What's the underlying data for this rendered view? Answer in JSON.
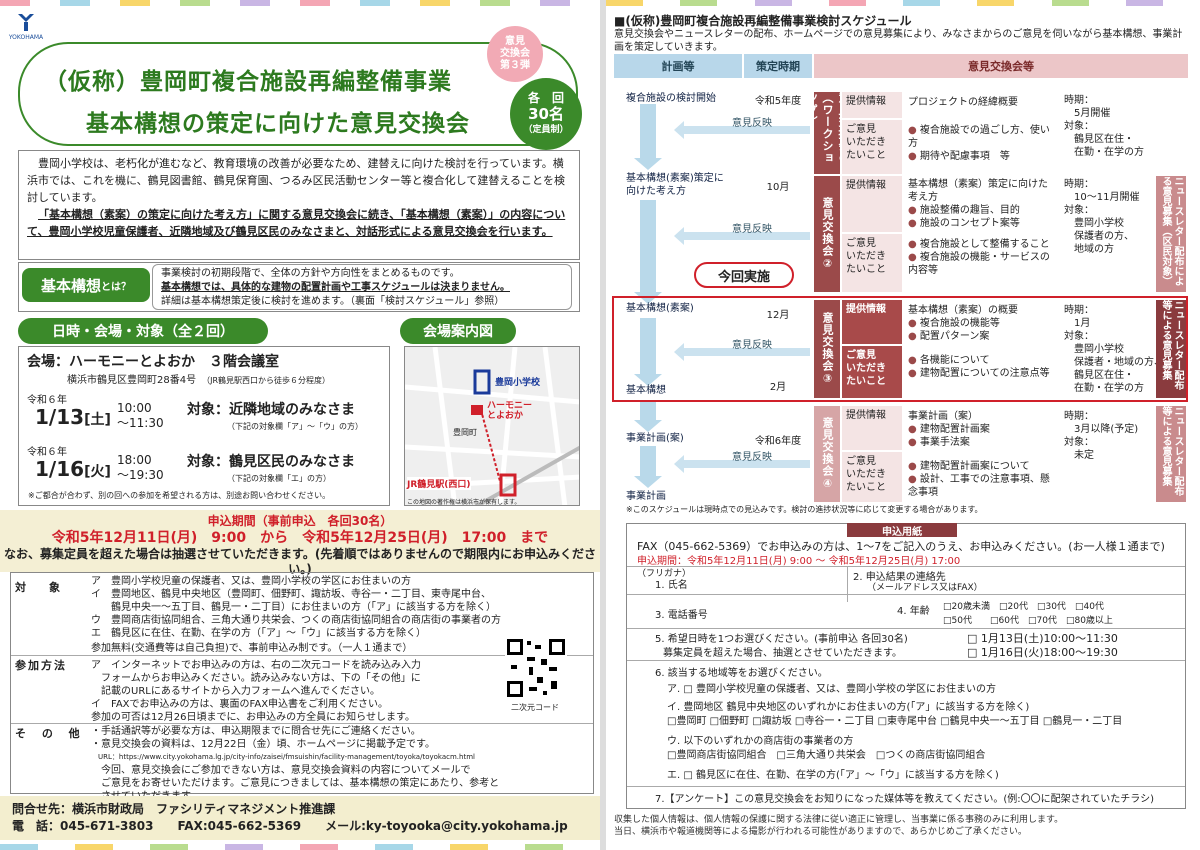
{
  "left": {
    "logo": {
      "text": "YOKOHAMA",
      "caption": "ヨコハマ"
    },
    "title_line1": "（仮称）豊岡町複合施設再編整備事業",
    "title_line2": "基本構想の策定に向けた意見交換会",
    "badge_round": [
      "意見",
      "交換会",
      "第３弾"
    ],
    "badge_capacity": [
      "各　回",
      "30名",
      "（定員制）"
    ],
    "intro": [
      "豊岡小学校は、老朽化が進むなど、教育環境の改善が必要なため、建替えに向けた検討を行っています。横浜市では、これを機に、鶴見図書館、鶴見保育園、つるみ区民活動センター等と複合化して建替えることを検討しています。",
      "「基本構想（素案）の策定に向けた考え方」に関する意見交換会に続き、「基本構想（素案）」の内容について、豊岡小学校児童保護者、近隣地域及び鶴見区民のみなさまと、対話形式による意見交換会を行います。"
    ],
    "kihon_label": "基本構想",
    "kihon_q": "とは？",
    "kihon_text": [
      "事業検討の初期段階で、全体の方針や方向性をまとめるものです。",
      "基本構想では、具体的な建物の配置計画や工事スケジュールは決まりません。",
      "詳細は基本構想策定後に検討を進めます。（裏面「検討スケジュール」参照）"
    ],
    "sec_datetime": "日時・会場・対象（全２回）",
    "sec_map": "会場案内図",
    "venue_label": "会場：ハーモニーとよおか　３階会議室",
    "venue_addr": "横浜市鶴見区豊岡町28番4号",
    "venue_access": "（JR鶴見駅西口から徒歩６分程度）",
    "session1": {
      "era": "令和６年",
      "date": "1/13",
      "dow": "[土]",
      "time1": "10:00",
      "time2": "～11:30",
      "target": "対象：近隣地域のみなさま",
      "note": "（下記の対象欄「ア」～「ウ」の方）"
    },
    "session2": {
      "era": "令和６年",
      "date": "1/16",
      "dow": "[火]",
      "time1": "18:00",
      "time2": "～19:30",
      "target": "対象：鶴見区民のみなさま",
      "note": "（下記の対象欄「エ」の方）"
    },
    "venue_footnote": "※ご都合が合わず、別の回への参加を希望される方は、別途お問い合わせください。",
    "map": {
      "school": "豊岡小学校",
      "harmony": "ハーモニー\nとよおか",
      "station": "JR鶴見駅(西口)",
      "town": "豊岡町",
      "caption": "この地図の著作権は横浜市が保有します。"
    },
    "apply": {
      "line1": "申込期間（事前申込　各回30名）",
      "line2": "令和5年12月11日(月)　9:00　から　令和5年12月25日(月)　17:00　まで",
      "line3": "なお、募集定員を超えた場合は抽選させていただきます。(先着順ではありませんので期限内にお申込みください。)"
    },
    "taisho_label": "対　象",
    "taisho": [
      "ア　豊岡小学校児童の保護者、又は、豊岡小学校の学区にお住まいの方",
      "イ　豊岡地区、鶴見中央地区（豊岡町、佃野町、諏訪坂、寺谷一・二丁目、東寺尾中台、",
      "　　鶴見中央一～五丁目、鶴見一・二丁目）にお住まいの方（「ア」に該当する方を除く）",
      "ウ　豊岡商店街協同組合、三角大通り共栄会、つくの商店街協同組合の商店街の事業者の方",
      "エ　鶴見区に在住、在勤、在学の方（「ア」～「ウ」に該当する方を除く）",
      "参加無料(交通費等は自己負担)で、事前申込み制です。（一人１通まで）"
    ],
    "method_label": "参加方法",
    "method": [
      "ア　インターネットでお申込みの方は、右の二次元コードを読み込み入力",
      "　フォームからお申込みください。読み込みない方は、下の「その他」に",
      "　記載のURLにあるサイトから入力フォームへ進んでください。",
      "イ　FAXでお申込みの方は、裏面のFAX申込書をご利用ください。",
      "参加の可否は12月26日頃までに、お申込みの方全員にお知らせします。"
    ],
    "qr_caption": "二次元コード",
    "other_label": "そ の 他",
    "other": [
      "・手話通訳等が必要な方は、申込期限までに問合せ先にご連絡ください。",
      "・意見交換会の資料は、12月22日（金）頃、ホームページに掲載予定です。",
      "　URL：https://www.city.yokohama.lg.jp/city-info/zaisei/fmsuishin/facility-management/toyoka/toyokacm.html",
      "　今回、意見交換会にご参加できない方は、意見交換会資料の内容についてメールで",
      "　ご意見をお寄せいただけます。ご意見につきましては、基本構想の策定にあたり、参考と",
      "　させていただきます。"
    ],
    "contact1": "問合せ先：横浜市財政局　ファシリティマネジメント推進課",
    "contact2": "電　話：045-671-3803　　FAX:045-662-5369　　メール:ky-toyooka@city.yokohama.jp"
  },
  "right": {
    "heading": "■(仮称)豊岡町複合施設再編整備事業検討スケジュール",
    "sub": "意見交換会やニュースレターの配布、ホームページでの意見募集により、みなさまからのご意見を伺いながら基本構想、事業計画を策定していきます。",
    "col_plan": "計画等",
    "col_time": "策定時期",
    "col_meeting": "意見交換会等",
    "steps": [
      "複合施設の検討開始",
      "基本構想(素案)策定に\n向けた考え方",
      "基本構想(素案)",
      "基本構想",
      "事業計画(案)",
      "事業計画"
    ],
    "whens": [
      "令和5年度",
      "10月",
      "12月",
      "2月",
      "令和6年度"
    ],
    "feedback": "意見反映",
    "now": "今回実施",
    "meetings": [
      {
        "label": "意見交換会①（ワークショップ）",
        "info": "提供情報",
        "info_text": "プロジェクトの経緯概要",
        "ask": "ご意見\nいただき\nたいこと",
        "asks": [
          "複合施設での過ごし方、使い方",
          "期待や配慮事項　等"
        ],
        "time": "時期：\n　5月開催\n対象：\n　鶴見区在住・\n　在勤・在学の方"
      },
      {
        "label": "意見交換会②",
        "info": "提供情報",
        "info_text": "基本構想（素案）策定に向けた考え方",
        "info_items": [
          "施設整備の趣旨、目的",
          "施設のコンセプト案等"
        ],
        "ask": "ご意見\nいただき\nたいこと",
        "asks": [
          "複合施設として整備すること",
          "複合施設の機能・サービスの内容等"
        ],
        "time": "時期：\n　10～11月開催\n対象：\n　豊岡小学校\n　保護者の方、\n　地域の方"
      },
      {
        "label": "意見交換会③",
        "info": "提供情報",
        "info_text": "基本構想（素案）の概要",
        "info_items": [
          "複合施設の機能等",
          "配置パターン案"
        ],
        "ask": "ご意見\nいただき\nたいこと",
        "asks": [
          "各機能について",
          "建物配置についての注意点等"
        ],
        "time": "時期：\n　1月\n対象：\n　豊岡小学校\n　保護者・地域の方、\n　鶴見区在住・\n　在勤・在学の方"
      },
      {
        "label": "意見交換会④",
        "info": "提供情報",
        "info_text": "事業計画（案）",
        "info_items": [
          "建物配置計画案",
          "事業手法案"
        ],
        "ask": "ご意見\nいただき\nたいこと",
        "asks": [
          "建物配置計画案について",
          "設計、工事での注意事項、懸念事項"
        ],
        "time": "時期：\n　3月以降(予定)\n対象：\n　未定"
      }
    ],
    "news": [
      "ニュースレター配布による意見募集（区民対象）",
      "ニュースレター配布等による意見募集",
      "ニュースレター配布等による意見募集"
    ],
    "schedule_note": "※このスケジュールは現時点での見込みです。検討の進捗状況等に応じて変更する場合があります。",
    "form": {
      "title": "申込用紙",
      "fax": "FAX（045-662-5369）でお申込みの方は、1～7をご記入のうえ、お申込みください。(お一人様１通まで)",
      "period": "申込期間：令和5年12月11日(月) 9:00 ～ 令和5年12月25日(月) 17:00",
      "furigana": "（フリガナ）",
      "f1": "1. 氏名",
      "f2": "2. 申込結果の連絡先",
      "f2sub": "（メールアドレス又はFAX）",
      "f3": "3. 電話番号",
      "f4": "4. 年齢",
      "ages": [
        "20歳未満",
        "20代",
        "30代",
        "40代",
        "50代",
        "60代",
        "70代",
        "80歳以上"
      ],
      "f5": "5. 希望日時を1つお選びください。(事前申込 各回30名)",
      "f5b": "募集定員を超えた場合、抽選とさせていただきます。",
      "d1": "1月13日(土)10:00～11:30",
      "d2": "1月16日(火)18:00～19:30",
      "f6": "6. 該当する地域等をお選びください。",
      "f6a": "ア. □ 豊岡小学校児童の保護者、又は、豊岡小学校の学区にお住まいの方",
      "f6i": "イ. 豊岡地区 鶴見中央地区のいずれかにお住まいの方(「ア」に該当する方を除く)",
      "f6i_items": [
        "豊岡町",
        "佃野町",
        "諏訪坂",
        "寺谷一・二丁目",
        "東寺尾中台",
        "鶴見中央一～五丁目",
        "鶴見一・二丁目"
      ],
      "f6u": "ウ. 以下のいずれかの商店街の事業者の方",
      "f6u_items": [
        "豊岡商店街協同組合",
        "三角大通り共栄会",
        "つくの商店街協同組合"
      ],
      "f6e": "エ. □ 鶴見区に在住、在勤、在学の方(「ア」～「ウ」に該当する方を除く)",
      "f7": "7.【アンケート】この意見交換会をお知りになった媒体等を教えてください。(例:〇〇に配架されていたチラシ)"
    },
    "privacy": "収集した個人情報は、個人情報の保護に関する法律に従い適正に管理し、当事業に係る事務のみに利用します。\n当日、横浜市や報道機関等による撮影が行われる可能性がありますので、あらかじめご了承ください。"
  },
  "colors": {
    "green": "#3b8a2a",
    "red": "#d0202a",
    "maroon": "#8a3b3e",
    "blue": "#b8d7ea"
  }
}
